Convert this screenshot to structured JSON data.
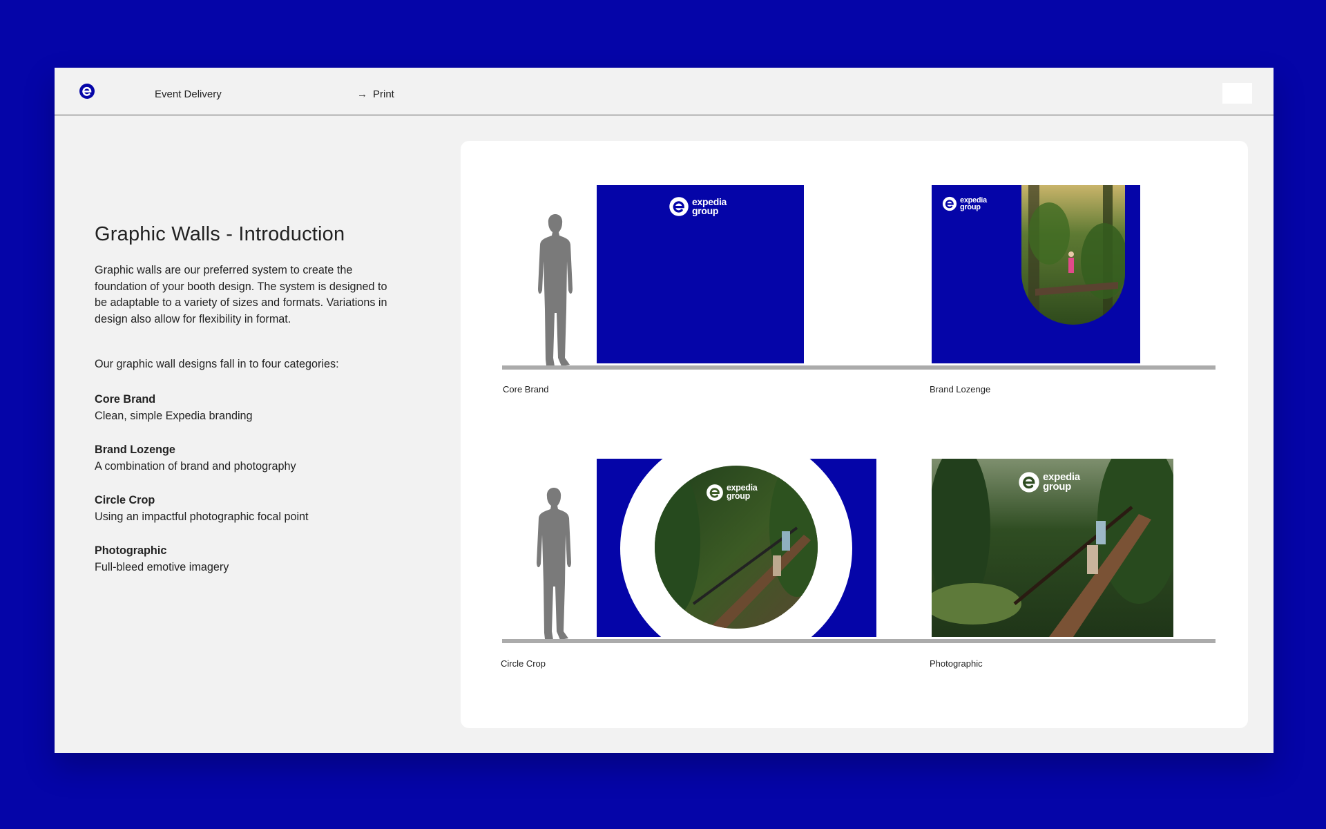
{
  "header": {
    "section": "Event Delivery",
    "page": "Print",
    "arrow": "→"
  },
  "content": {
    "title": "Graphic Walls - Introduction",
    "intro": "Graphic walls are our preferred system to create the foundation of your booth design. The system is designed to be adaptable to a variety of sizes and formats. Variations in design also allow for flexibility in format.",
    "categories_lead": "Our graphic wall designs fall in to four categories:",
    "categories": [
      {
        "title": "Core Brand",
        "desc": "Clean, simple Expedia branding"
      },
      {
        "title": "Brand Lozenge",
        "desc": "A combination of brand and photography"
      },
      {
        "title": "Circle Crop",
        "desc": "Using an impactful photographic focal point"
      },
      {
        "title": "Photographic",
        "desc": "Full-bleed emotive imagery"
      }
    ]
  },
  "walls": [
    {
      "label": "Core Brand"
    },
    {
      "label": "Brand Lozenge"
    },
    {
      "label": "Circle Crop"
    },
    {
      "label": "Photographic"
    }
  ],
  "brand_logo": {
    "line1": "expedia",
    "line2": "group"
  },
  "colors": {
    "brand_blue": "#0505A8",
    "panel_bg": "#F2F2F2",
    "floor_gray": "#ABABAB",
    "silhouette_gray": "#7A7A7A"
  },
  "icons": {
    "app_logo": "expedia-e-icon",
    "crumb_arrow": "arrow-right-icon"
  }
}
